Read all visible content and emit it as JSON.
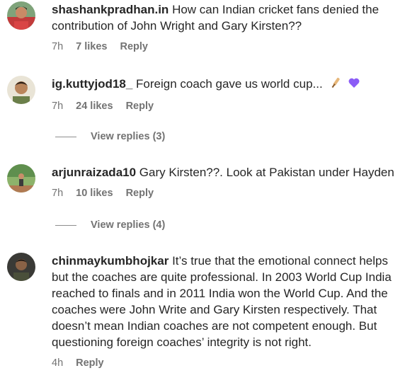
{
  "comments": [
    {
      "username": "shashankpradhan.in",
      "text": "How can Indian cricket fans denied the contribution of John Wright and Gary Kirsten??",
      "time": "7h",
      "likes": "7 likes",
      "reply": "Reply"
    },
    {
      "username": "ig.kuttyjod18_",
      "text": "Foreign coach gave us world cup...",
      "emojis": [
        "cricket-bat-icon",
        "purple-heart-icon"
      ],
      "time": "7h",
      "likes": "24 likes",
      "reply": "Reply",
      "view_replies": "View replies (3)"
    },
    {
      "username": "arjunraizada10",
      "text": "Gary Kirsten??. Look at Pakistan under Hayden",
      "time": "7h",
      "likes": "10 likes",
      "reply": "Reply",
      "view_replies": "View replies (4)"
    },
    {
      "username": "chinmaykumbhojkar",
      "text": "It’s true that the emotional connect helps but the coaches are quite professional. In 2003 World Cup India reached to finals and in 2011 India won the World Cup. And the coaches were John Write and Gary Kirsten respectively. That doesn’t mean Indian coaches are not competent enough. But questioning foreign coaches’ integrity is not right.",
      "time": "4h",
      "reply": "Reply"
    }
  ],
  "colors": {
    "text": "#262626",
    "meta": "#737373",
    "heart": "#8b5cf6"
  }
}
